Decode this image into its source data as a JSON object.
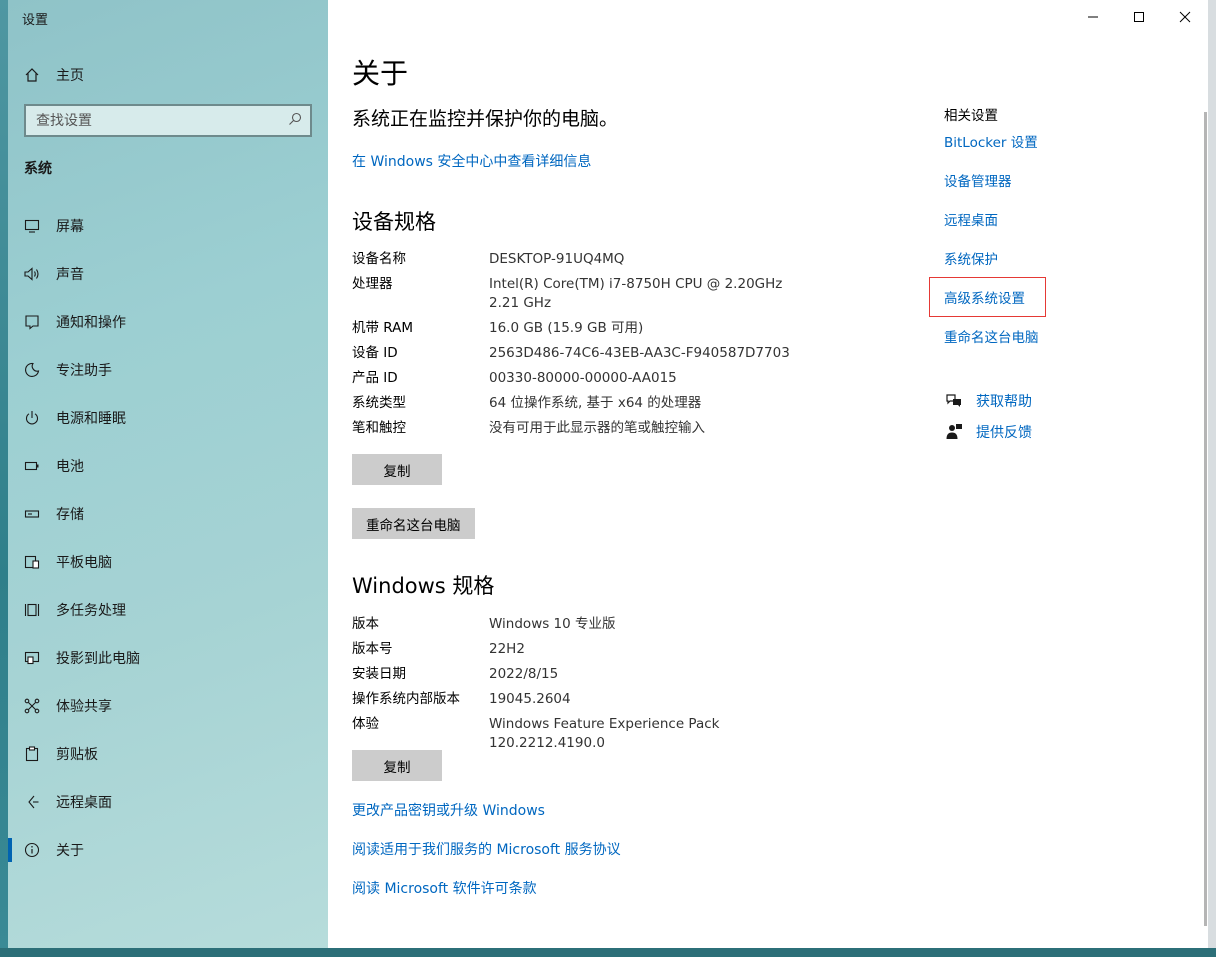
{
  "window": {
    "title": "设置"
  },
  "sidebar": {
    "home_label": "主页",
    "search_placeholder": "查找设置",
    "section_label": "系统",
    "items": [
      {
        "label": "屏幕",
        "icon": "monitor-icon"
      },
      {
        "label": "声音",
        "icon": "speaker-icon"
      },
      {
        "label": "通知和操作",
        "icon": "notification-icon"
      },
      {
        "label": "专注助手",
        "icon": "moon-icon"
      },
      {
        "label": "电源和睡眠",
        "icon": "power-icon"
      },
      {
        "label": "电池",
        "icon": "battery-icon"
      },
      {
        "label": "存储",
        "icon": "storage-icon"
      },
      {
        "label": "平板电脑",
        "icon": "tablet-icon"
      },
      {
        "label": "多任务处理",
        "icon": "multitask-icon"
      },
      {
        "label": "投影到此电脑",
        "icon": "project-icon"
      },
      {
        "label": "体验共享",
        "icon": "share-icon"
      },
      {
        "label": "剪贴板",
        "icon": "clipboard-icon"
      },
      {
        "label": "远程桌面",
        "icon": "remote-desktop-icon"
      },
      {
        "label": "关于",
        "icon": "info-icon",
        "active": true
      }
    ]
  },
  "main": {
    "title": "关于",
    "status": "系统正在监控并保护你的电脑。",
    "security_link": "在 Windows 安全中心中查看详细信息",
    "device_specs": {
      "heading": "设备规格",
      "rows": [
        {
          "key": "设备名称",
          "value": "DESKTOP-91UQ4MQ"
        },
        {
          "key": "处理器",
          "value": "Intel(R) Core(TM) i7-8750H CPU @ 2.20GHz   2.21 GHz"
        },
        {
          "key": "机带 RAM",
          "value": "16.0 GB (15.9 GB 可用)"
        },
        {
          "key": "设备 ID",
          "value": "2563D486-74C6-43EB-AA3C-F940587D7703"
        },
        {
          "key": "产品 ID",
          "value": "00330-80000-00000-AA015"
        },
        {
          "key": "系统类型",
          "value": "64 位操作系统, 基于 x64 的处理器"
        },
        {
          "key": "笔和触控",
          "value": "没有可用于此显示器的笔或触控输入"
        }
      ],
      "copy_button": "复制",
      "rename_button": "重命名这台电脑"
    },
    "windows_specs": {
      "heading": "Windows 规格",
      "rows": [
        {
          "key": "版本",
          "value": "Windows 10 专业版"
        },
        {
          "key": "版本号",
          "value": "22H2"
        },
        {
          "key": "安装日期",
          "value": "2022/8/15"
        },
        {
          "key": "操作系统内部版本",
          "value": "19045.2604"
        },
        {
          "key": "体验",
          "value": "Windows Feature Experience Pack 120.2212.4190.0"
        }
      ],
      "copy_button": "复制"
    },
    "links": [
      "更改产品密钥或升级 Windows",
      "阅读适用于我们服务的 Microsoft 服务协议",
      "阅读 Microsoft 软件许可条款"
    ]
  },
  "related": {
    "title": "相关设置",
    "links": [
      "BitLocker 设置",
      "设备管理器",
      "远程桌面",
      "系统保护",
      "高级系统设置",
      "重命名这台电脑"
    ],
    "help": [
      {
        "label": "获取帮助",
        "icon": "help-chat-icon"
      },
      {
        "label": "提供反馈",
        "icon": "feedback-icon"
      }
    ]
  },
  "colors": {
    "link": "#0067c0",
    "accent": "#0063b1",
    "highlight": "#e53935"
  }
}
